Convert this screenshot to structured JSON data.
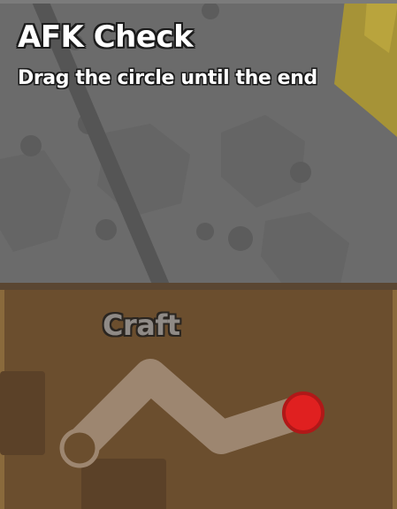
{
  "dialog": {
    "title": "AFK Check",
    "instruction": "Drag the circle until the end"
  },
  "world": {
    "zone_label": "Craft"
  },
  "colors": {
    "overlay": "#6a6a6a",
    "ground": "#6b4e2e",
    "path": "#9d8670",
    "start_ring": "#9d8670",
    "handle": "#e02020",
    "handle_border": "#b01818",
    "accent_yellow": "#c8a830"
  },
  "drag_check": {
    "progress": 0
  }
}
